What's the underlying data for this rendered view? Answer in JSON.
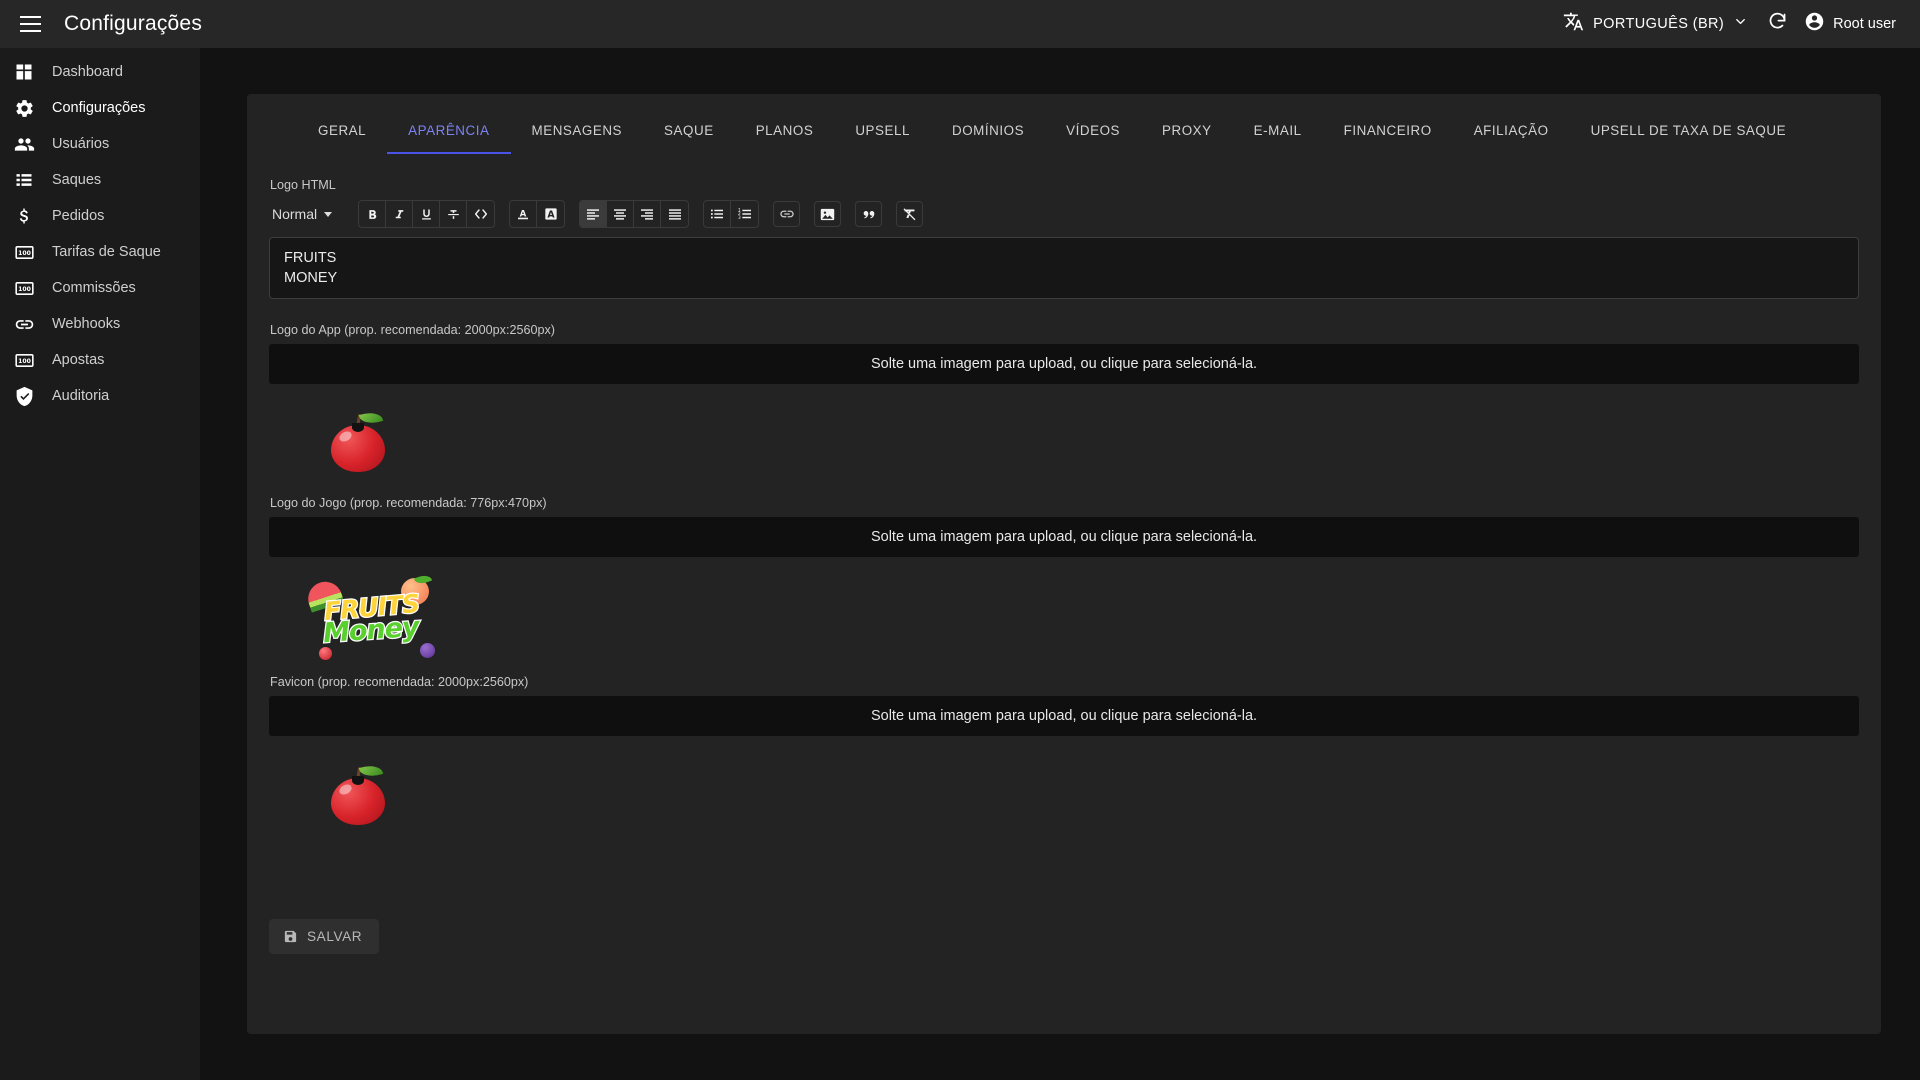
{
  "appbar": {
    "menu_icon": "hamburger-icon",
    "title": "Configurações",
    "language_icon": "translate-icon",
    "language_label": "PORTUGUÊS (BR)",
    "language_caret_icon": "chevron-down-icon",
    "refresh_icon": "refresh-icon",
    "account_icon": "account-circle-icon",
    "user_label": "Root user"
  },
  "sidebar": {
    "items": [
      {
        "label": "Dashboard",
        "icon": "dashboard-icon",
        "active": false
      },
      {
        "label": "Configurações",
        "icon": "gear-icon",
        "active": true
      },
      {
        "label": "Usuários",
        "icon": "people-icon",
        "active": false
      },
      {
        "label": "Saques",
        "icon": "list-icon",
        "active": false
      },
      {
        "label": "Pedidos",
        "icon": "dollar-icon",
        "active": false
      },
      {
        "label": "Tarifas de Saque",
        "icon": "money-100-icon",
        "active": false
      },
      {
        "label": "Commissões",
        "icon": "money-100-icon",
        "active": false
      },
      {
        "label": "Webhooks",
        "icon": "link-icon",
        "active": false
      },
      {
        "label": "Apostas",
        "icon": "money-100-icon",
        "active": false
      },
      {
        "label": "Auditoria",
        "icon": "shield-check-icon",
        "active": false
      }
    ]
  },
  "tabs": [
    {
      "label": "GERAL",
      "active": false
    },
    {
      "label": "APARÊNCIA",
      "active": true
    },
    {
      "label": "MENSAGENS",
      "active": false
    },
    {
      "label": "SAQUE",
      "active": false
    },
    {
      "label": "PLANOS",
      "active": false
    },
    {
      "label": "UPSELL",
      "active": false
    },
    {
      "label": "DOMÍNIOS",
      "active": false
    },
    {
      "label": "VÍDEOS",
      "active": false
    },
    {
      "label": "PROXY",
      "active": false
    },
    {
      "label": "E-MAIL",
      "active": false
    },
    {
      "label": "FINANCEIRO",
      "active": false
    },
    {
      "label": "AFILIAÇÃO",
      "active": false
    },
    {
      "label": "UPSELL DE TAXA DE SAQUE",
      "active": false
    }
  ],
  "editor": {
    "label": "Logo HTML",
    "format_select": "Normal",
    "toolbar": {
      "bold": "bold-icon",
      "italic": "italic-icon",
      "underline": "underline-icon",
      "strikethrough": "strikethrough-icon",
      "code": "code-icon",
      "text_color": "text-color-icon",
      "background_color": "background-color-icon",
      "align_left": "align-left-icon",
      "align_center": "align-center-icon",
      "align_right": "align-right-icon",
      "align_justify": "align-justify-icon",
      "bullet_list": "bullet-list-icon",
      "numbered_list": "numbered-list-icon",
      "link": "link-icon",
      "image": "image-icon",
      "quote": "quote-icon",
      "clear_format": "clear-format-icon"
    },
    "content_line_1": "FRUITS",
    "content_line_2": "MONEY"
  },
  "uploads": [
    {
      "label": "Logo do App (prop. recomendada: 2000px:2560px)",
      "dropzone_text": "Solte uma imagem para upload, ou clique para selecioná-la.",
      "preview": "apple-logo-image"
    },
    {
      "label": "Logo do Jogo (prop. recomendada: 776px:470px)",
      "dropzone_text": "Solte uma imagem para upload, ou clique para selecioná-la.",
      "preview": "fruits-money-game-logo-image"
    },
    {
      "label": "Favicon (prop. recomendada: 2000px:2560px)",
      "dropzone_text": "Solte uma imagem para upload, ou clique para selecioná-la.",
      "preview": "apple-favicon-image"
    }
  ],
  "footer": {
    "save_icon": "save-icon",
    "save_label": "SALVAR"
  },
  "colors": {
    "accent": "#4a55e8",
    "tab_active_text": "#7c83f5",
    "appbar_bg": "#272727",
    "sidebar_bg": "#1b1b1b",
    "card_bg": "#232323",
    "page_bg": "#121212"
  }
}
